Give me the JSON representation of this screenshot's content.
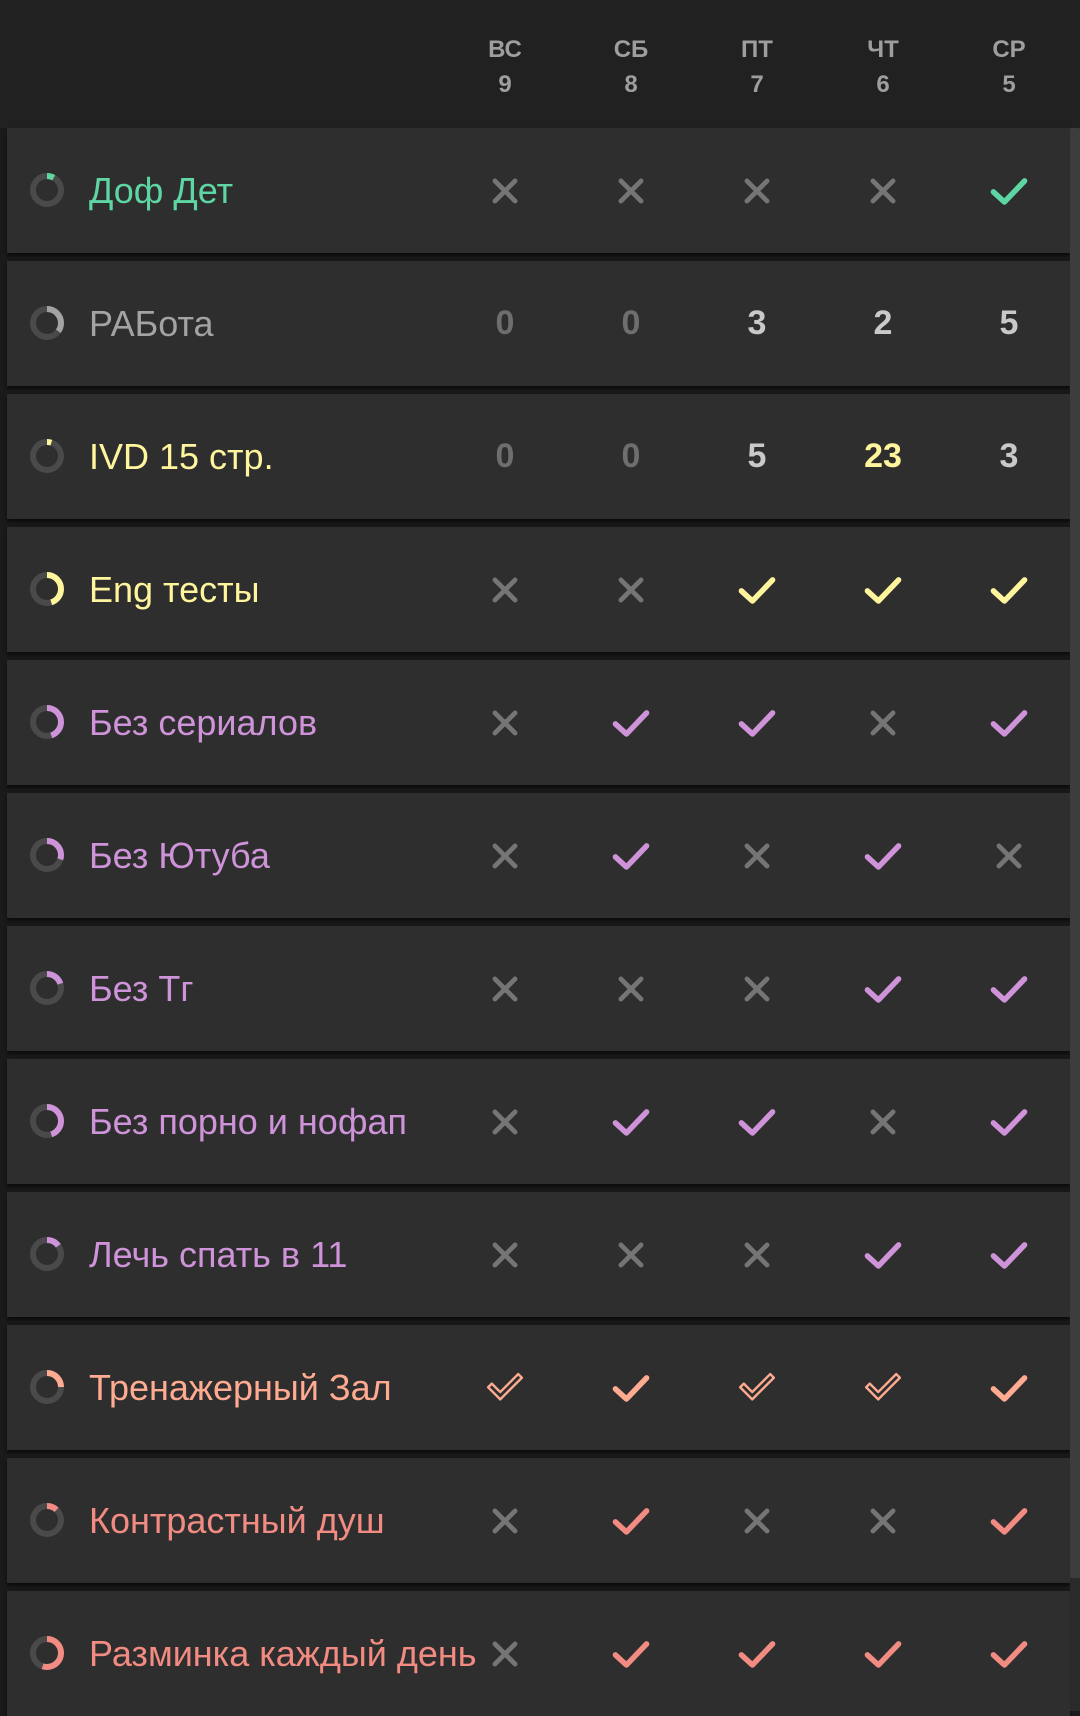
{
  "theme": {
    "unchecked_color": "#757575",
    "zero_color": "#6e6e6e",
    "number_color": "#c9c9c9",
    "ring_track_color": "#4a4a4a"
  },
  "header": {
    "days": [
      {
        "name": "ВС",
        "date": "9"
      },
      {
        "name": "СБ",
        "date": "8"
      },
      {
        "name": "ПТ",
        "date": "7"
      },
      {
        "name": "ЧТ",
        "date": "6"
      },
      {
        "name": "СР",
        "date": "5"
      }
    ]
  },
  "habits": [
    {
      "name": "Доф Дет",
      "color": "#5ed6a3",
      "score": 0.08,
      "type": "check",
      "entries": [
        "x",
        "x",
        "x",
        "x",
        "check"
      ]
    },
    {
      "name": "РАБота",
      "color": "#a3a3a3",
      "name_color": "#a3a3a3",
      "score": 0.35,
      "type": "number",
      "entries": [
        "0",
        "0",
        "3",
        "2",
        "5"
      ],
      "highlight": []
    },
    {
      "name": "IVD 15 стр.",
      "color": "#fff59d",
      "score": 0.05,
      "type": "number",
      "entries": [
        "0",
        "0",
        "5",
        "23",
        "3"
      ],
      "highlight": [
        3
      ]
    },
    {
      "name": "Eng тесты",
      "color": "#fff59d",
      "score": 0.45,
      "type": "check",
      "entries": [
        "x",
        "x",
        "check",
        "check",
        "check"
      ]
    },
    {
      "name": "Без сериалов",
      "color": "#ce93d8",
      "score": 0.45,
      "type": "check",
      "entries": [
        "x",
        "check",
        "check",
        "x",
        "check"
      ]
    },
    {
      "name": "Без Ютуба",
      "color": "#ce93d8",
      "score": 0.3,
      "type": "check",
      "entries": [
        "x",
        "check",
        "x",
        "check",
        "x"
      ]
    },
    {
      "name": "Без Тг",
      "color": "#ce93d8",
      "score": 0.2,
      "type": "check",
      "entries": [
        "x",
        "x",
        "x",
        "check",
        "check"
      ]
    },
    {
      "name": "Без порно и нофап",
      "color": "#ce93d8",
      "score": 0.45,
      "type": "check",
      "entries": [
        "x",
        "check",
        "check",
        "x",
        "check"
      ]
    },
    {
      "name": "Лечь спать в 11",
      "color": "#ce93d8",
      "score": 0.15,
      "type": "check",
      "entries": [
        "x",
        "x",
        "x",
        "check",
        "check"
      ]
    },
    {
      "name": "Тренажерный Зал",
      "color": "#ffab91",
      "score": 0.25,
      "type": "check",
      "entries": [
        "skip",
        "check",
        "skip",
        "skip",
        "check"
      ]
    },
    {
      "name": "Контрастный душ",
      "color": "#f28b82",
      "score": 0.12,
      "type": "check",
      "entries": [
        "x",
        "check",
        "x",
        "x",
        "check"
      ]
    },
    {
      "name": "Разминка каждый день",
      "color": "#f28b82",
      "score": 0.55,
      "type": "check",
      "entries": [
        "x",
        "check",
        "check",
        "check",
        "check"
      ]
    }
  ]
}
